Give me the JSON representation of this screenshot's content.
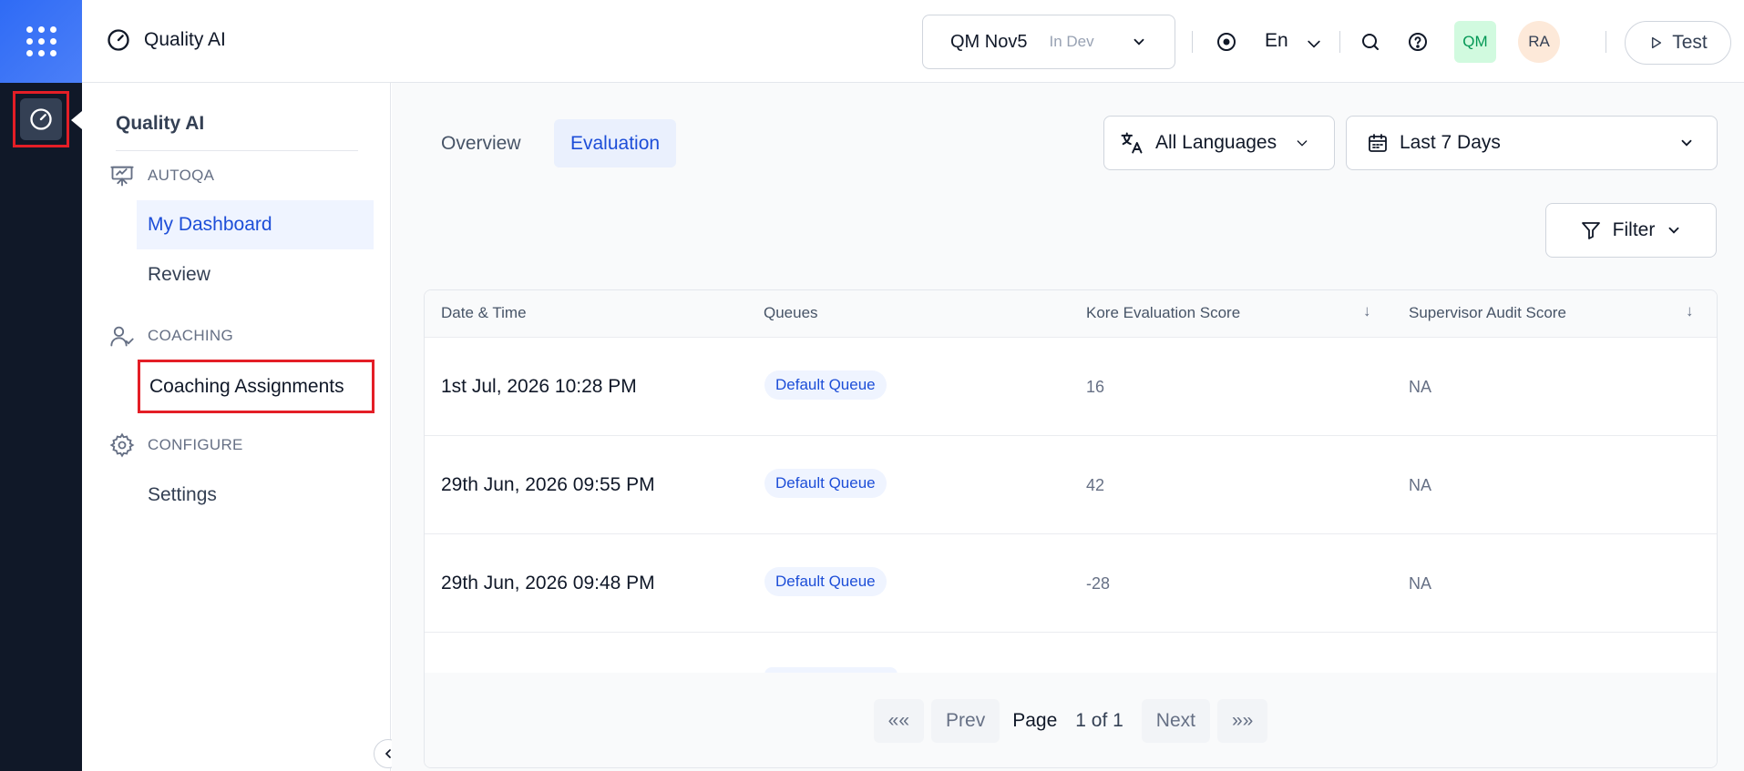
{
  "header": {
    "app_title": "Quality AI",
    "env_name": "QM Nov5",
    "env_tag": "In Dev",
    "language": "En",
    "avatar_qm": "QM",
    "avatar_ra": "RA",
    "test_label": "Test"
  },
  "sidebar": {
    "title": "Quality AI",
    "sections": {
      "autoqa": "AUTOQA",
      "coaching": "COACHING",
      "configure": "CONFIGURE"
    },
    "items": {
      "my_dashboard": "My Dashboard",
      "review": "Review",
      "coaching_assignments": "Coaching Assignments",
      "settings": "Settings"
    }
  },
  "main": {
    "tabs": [
      "Overview",
      "Evaluation"
    ],
    "language_filter": "All Languages",
    "date_filter": "Last 7 Days",
    "filter_label": "Filter",
    "table": {
      "columns": [
        "Date & Time",
        "Queues",
        "Kore Evaluation Score",
        "Supervisor Audit Score"
      ],
      "sort_icon": "↓",
      "rows": [
        {
          "date": "1st Jul, 2026 10:28 PM",
          "queue": "Default Queue",
          "score": "16",
          "audit": "NA"
        },
        {
          "date": "29th Jun, 2026 09:55 PM",
          "queue": "Default Queue",
          "score": "42",
          "audit": "NA"
        },
        {
          "date": "29th Jun, 2026 09:48 PM",
          "queue": "Default Queue",
          "score": "-28",
          "audit": "NA"
        }
      ]
    },
    "pagination": {
      "first": "«« ",
      "prev": "Prev",
      "page_label": "Page",
      "page_value": "1 of 1",
      "next": "Next",
      "last": "»»"
    }
  }
}
